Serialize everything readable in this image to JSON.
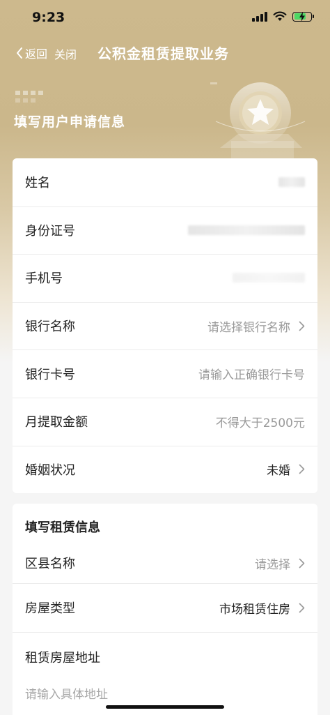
{
  "status_bar": {
    "time": "9:23"
  },
  "nav": {
    "back_label": "返回",
    "close_label": "关闭",
    "title": "公积金租赁提取业务"
  },
  "applicant_section": {
    "title": "填写用户申请信息",
    "fields": [
      {
        "label": "姓名"
      },
      {
        "label": "身份证号"
      },
      {
        "label": "手机号"
      },
      {
        "label": "银行名称",
        "placeholder": "请选择银行名称"
      },
      {
        "label": "银行卡号",
        "placeholder": "请输入正确银行卡号"
      },
      {
        "label": "月提取金额",
        "placeholder": "不得大于2500元"
      },
      {
        "label": "婚姻状况",
        "value": "未婚"
      }
    ]
  },
  "rental_section": {
    "title": "填写租赁信息",
    "fields": [
      {
        "label": "区县名称",
        "placeholder": "请选择"
      },
      {
        "label": "房屋类型",
        "value": "市场租赁住房"
      }
    ],
    "address": {
      "label": "租赁房屋地址",
      "placeholder": "请输入具体地址"
    }
  },
  "icons": [
    "back-chevron-icon",
    "chevron-right-icon",
    "star-badge-icon",
    "wifi-icon",
    "signal-icon",
    "battery-charging-icon"
  ],
  "colors": {
    "header_gold": "#cbb78b",
    "text_dark": "#222222",
    "placeholder_gray": "#9a9a9a"
  }
}
